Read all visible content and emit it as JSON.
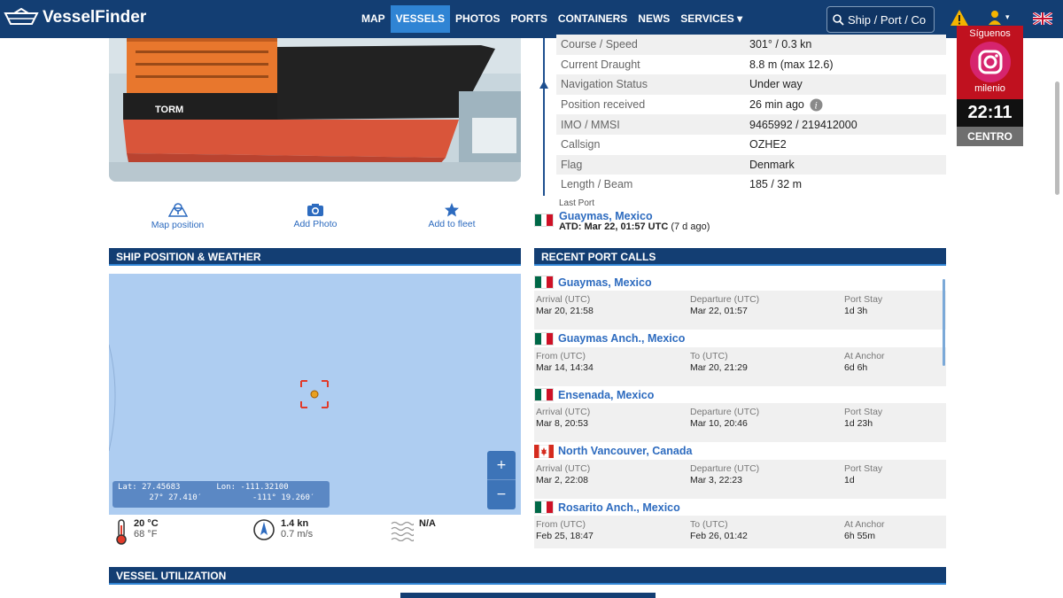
{
  "header": {
    "logo_text": "VesselFinder",
    "nav": [
      "MAP",
      "VESSELS",
      "PHOTOS",
      "PORTS",
      "CONTAINERS",
      "NEWS",
      "SERVICES"
    ],
    "active_nav": "VESSELS",
    "search_placeholder": "Ship / Port / Co",
    "brand_color": "#133e73",
    "accent_color": "#2f84d4"
  },
  "vessel_info": [
    {
      "label": "Course / Speed",
      "value": "301° / 0.3 kn"
    },
    {
      "label": "Current Draught",
      "value": "8.8 m (max 12.6)"
    },
    {
      "label": "Navigation Status",
      "value": "Under way"
    },
    {
      "label": "Position received",
      "value": "26 min ago"
    },
    {
      "label": "IMO / MMSI",
      "value": "9465992 / 219412000"
    },
    {
      "label": "Callsign",
      "value": "OZHE2"
    },
    {
      "label": "Flag",
      "value": "Denmark"
    },
    {
      "label": "Length / Beam",
      "value": "185 / 32 m"
    }
  ],
  "actions": {
    "map_position": "Map position",
    "add_photo": "Add Photo",
    "add_to_fleet": "Add to fleet"
  },
  "last_port": {
    "caption": "Last Port",
    "name": "Guaymas, Mexico",
    "atd": "ATD: Mar 22, 01:57 UTC",
    "ago": "(7 d ago)"
  },
  "sections": {
    "position_weather": "SHIP POSITION & WEATHER",
    "recent_calls": "RECENT PORT CALLS",
    "utilization": "VESSEL UTILIZATION"
  },
  "map": {
    "lat_label": "Lat:",
    "lat_dec": "27.45683",
    "lat_dms": "27° 27.410′",
    "lon_label": "Lon:",
    "lon_dec": "-111.32100",
    "lon_dms": "-111° 19.260′",
    "zoom_in": "+",
    "zoom_out": "−"
  },
  "weather": {
    "temp_c": "20 °C",
    "temp_f": "68 °F",
    "wind_kn": "1.4 kn",
    "wind_ms": "0.7 m/s",
    "waves": "N/A"
  },
  "port_calls": [
    {
      "port": "Guaymas, Mexico",
      "flag": "mx",
      "h1": "Arrival (UTC)",
      "v1": "Mar 20, 21:58",
      "h2": "Departure (UTC)",
      "v2": "Mar 22, 01:57",
      "h3": "Port Stay",
      "v3": "1d 3h"
    },
    {
      "port": "Guaymas Anch., Mexico",
      "flag": "mx",
      "h1": "From (UTC)",
      "v1": "Mar 14, 14:34",
      "h2": "To (UTC)",
      "v2": "Mar 20, 21:29",
      "h3": "At Anchor",
      "v3": "6d 6h"
    },
    {
      "port": "Ensenada, Mexico",
      "flag": "mx",
      "h1": "Arrival (UTC)",
      "v1": "Mar 8, 20:53",
      "h2": "Departure (UTC)",
      "v2": "Mar 10, 20:46",
      "h3": "Port Stay",
      "v3": "1d 23h"
    },
    {
      "port": "North Vancouver, Canada",
      "flag": "ca",
      "h1": "Arrival (UTC)",
      "v1": "Mar 2, 22:08",
      "h2": "Departure (UTC)",
      "v2": "Mar 3, 22:23",
      "h3": "Port Stay",
      "v3": "1d"
    },
    {
      "port": "Rosarito Anch., Mexico",
      "flag": "mx",
      "h1": "From (UTC)",
      "v1": "Feb 25, 18:47",
      "h2": "To (UTC)",
      "v2": "Feb 26, 01:42",
      "h3": "At Anchor",
      "v3": "6h 55m"
    }
  ],
  "overlay": {
    "follow": "Síguenos",
    "brand": "milenio",
    "time": "22:11",
    "city": "CENTRO"
  }
}
